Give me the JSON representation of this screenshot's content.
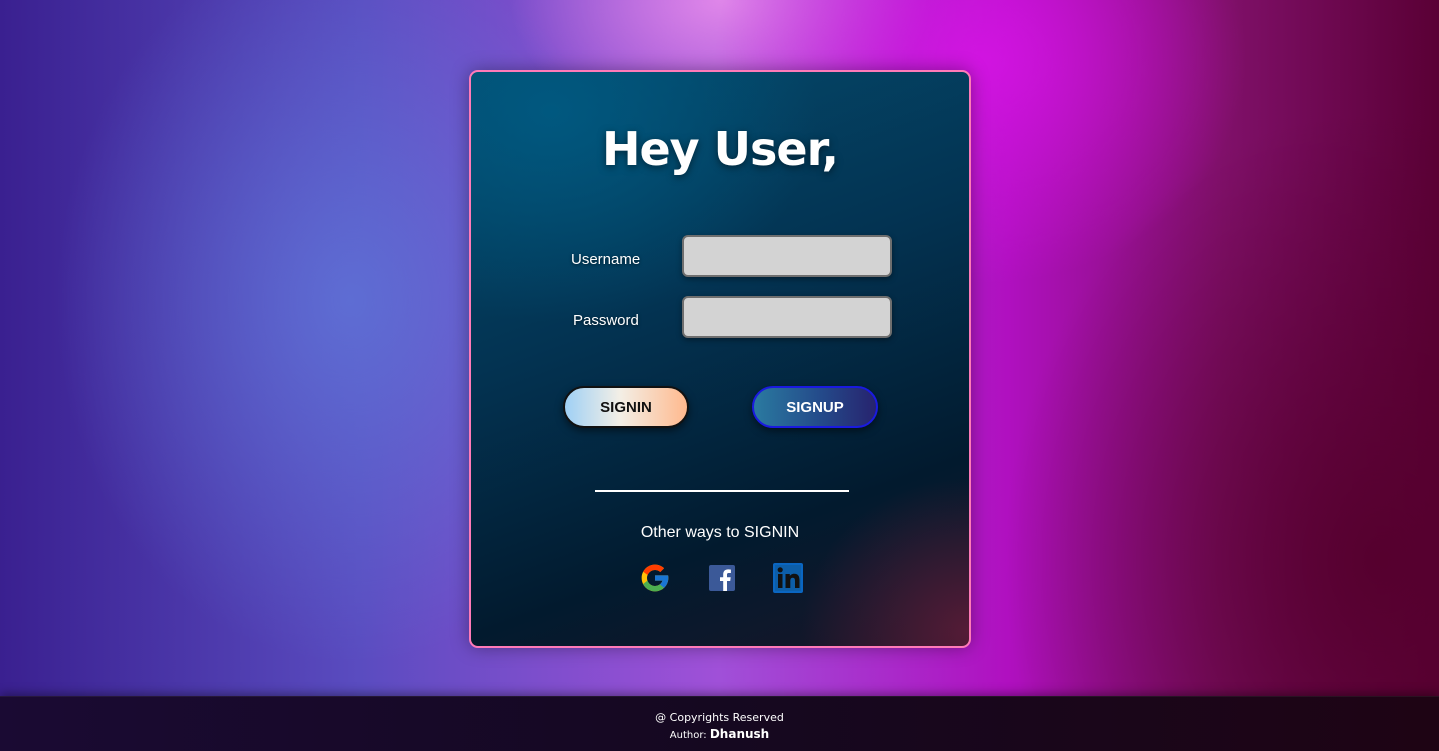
{
  "card": {
    "title": "Hey User,",
    "username_label": "Username",
    "username_value": "",
    "password_label": "Password",
    "password_value": "",
    "signin_label": "SIGNIN",
    "signup_label": "SIGNUP",
    "other_ways": "Other ways to SIGNIN",
    "social": [
      {
        "name": "google-icon",
        "color": "#4285F4"
      },
      {
        "name": "facebook-icon",
        "color": "#3b5998"
      },
      {
        "name": "linkedin-icon",
        "color": "#0a66c2"
      }
    ]
  },
  "footer": {
    "copyright": "@ Copyrights Reserved",
    "author_label": "Author:",
    "author_name": "Dhanush"
  },
  "colors": {
    "card_border": "#ff7ab8",
    "input_bg": "#d3d3d3",
    "signup_border": "#1a1ae0"
  }
}
